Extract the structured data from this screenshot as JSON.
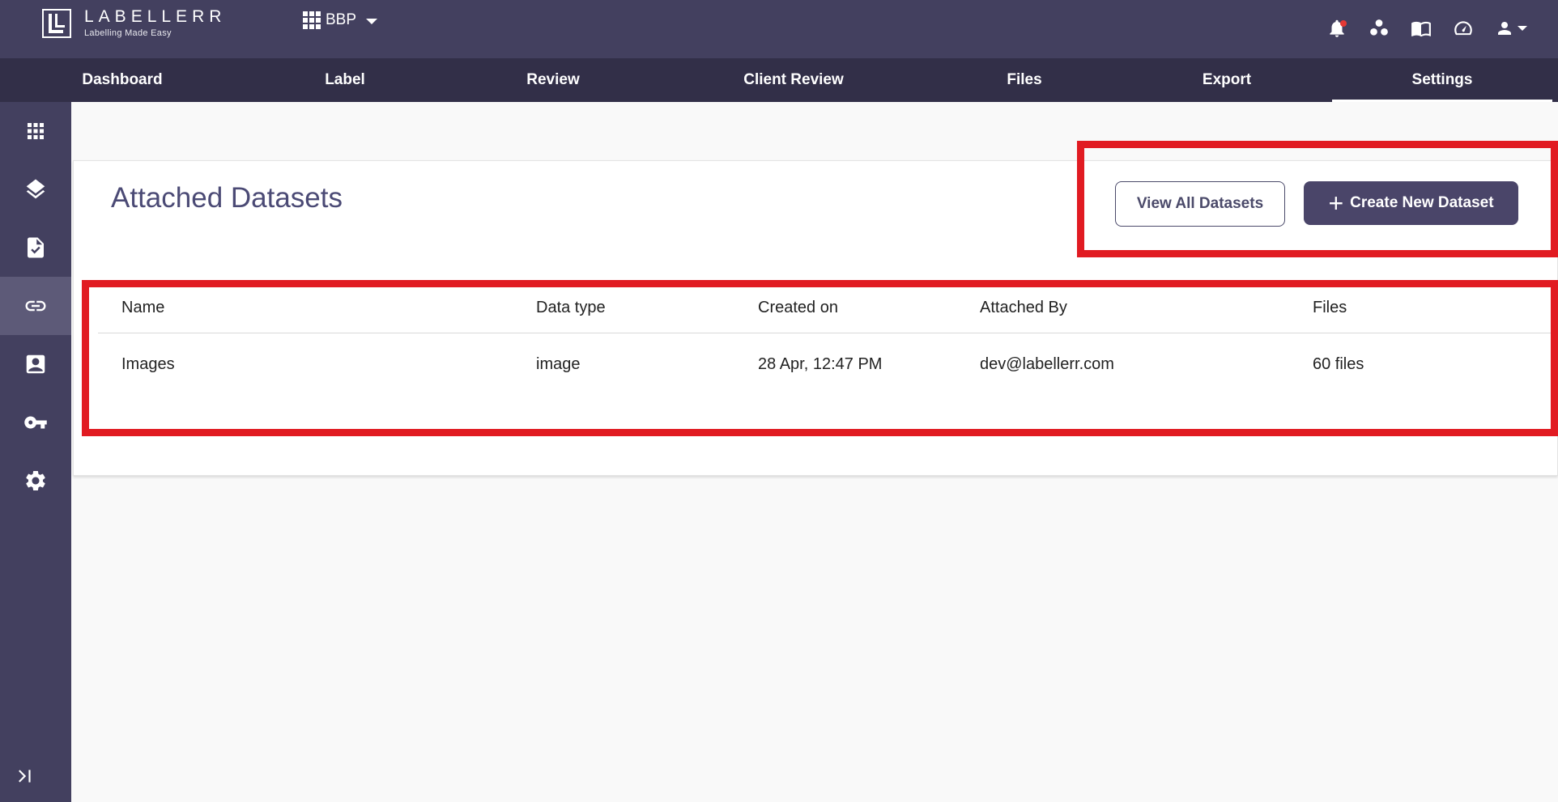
{
  "header": {
    "logo_name": "LABELLERR",
    "logo_tagline": "Labelling Made Easy",
    "project_name": "BBP"
  },
  "nav": {
    "tabs": [
      {
        "label": "Dashboard"
      },
      {
        "label": "Label"
      },
      {
        "label": "Review"
      },
      {
        "label": "Client Review"
      },
      {
        "label": "Files"
      },
      {
        "label": "Export"
      },
      {
        "label": "Settings"
      }
    ],
    "active_tab": "Settings"
  },
  "sidebar": {
    "items": [
      "grid-icon",
      "layers-icon",
      "file-check-icon",
      "link-icon",
      "contact-icon",
      "key-icon",
      "gear-icon"
    ],
    "active_item": "link-icon"
  },
  "main": {
    "title": "Attached Datasets",
    "view_all_label": "View All Datasets",
    "create_label": "Create New Dataset",
    "columns": [
      "Name",
      "Data type",
      "Created on",
      "Attached By",
      "Files"
    ],
    "rows": [
      [
        "Images",
        "image",
        "28 Apr, 12:47 PM",
        "dev@labellerr.com",
        "60 files"
      ]
    ]
  },
  "colors": {
    "header_bg": "#43405f",
    "nav_bg": "#322f48",
    "accent": "#4a4569",
    "annotation": "#e11b22",
    "notification_dot": "#e53935"
  }
}
